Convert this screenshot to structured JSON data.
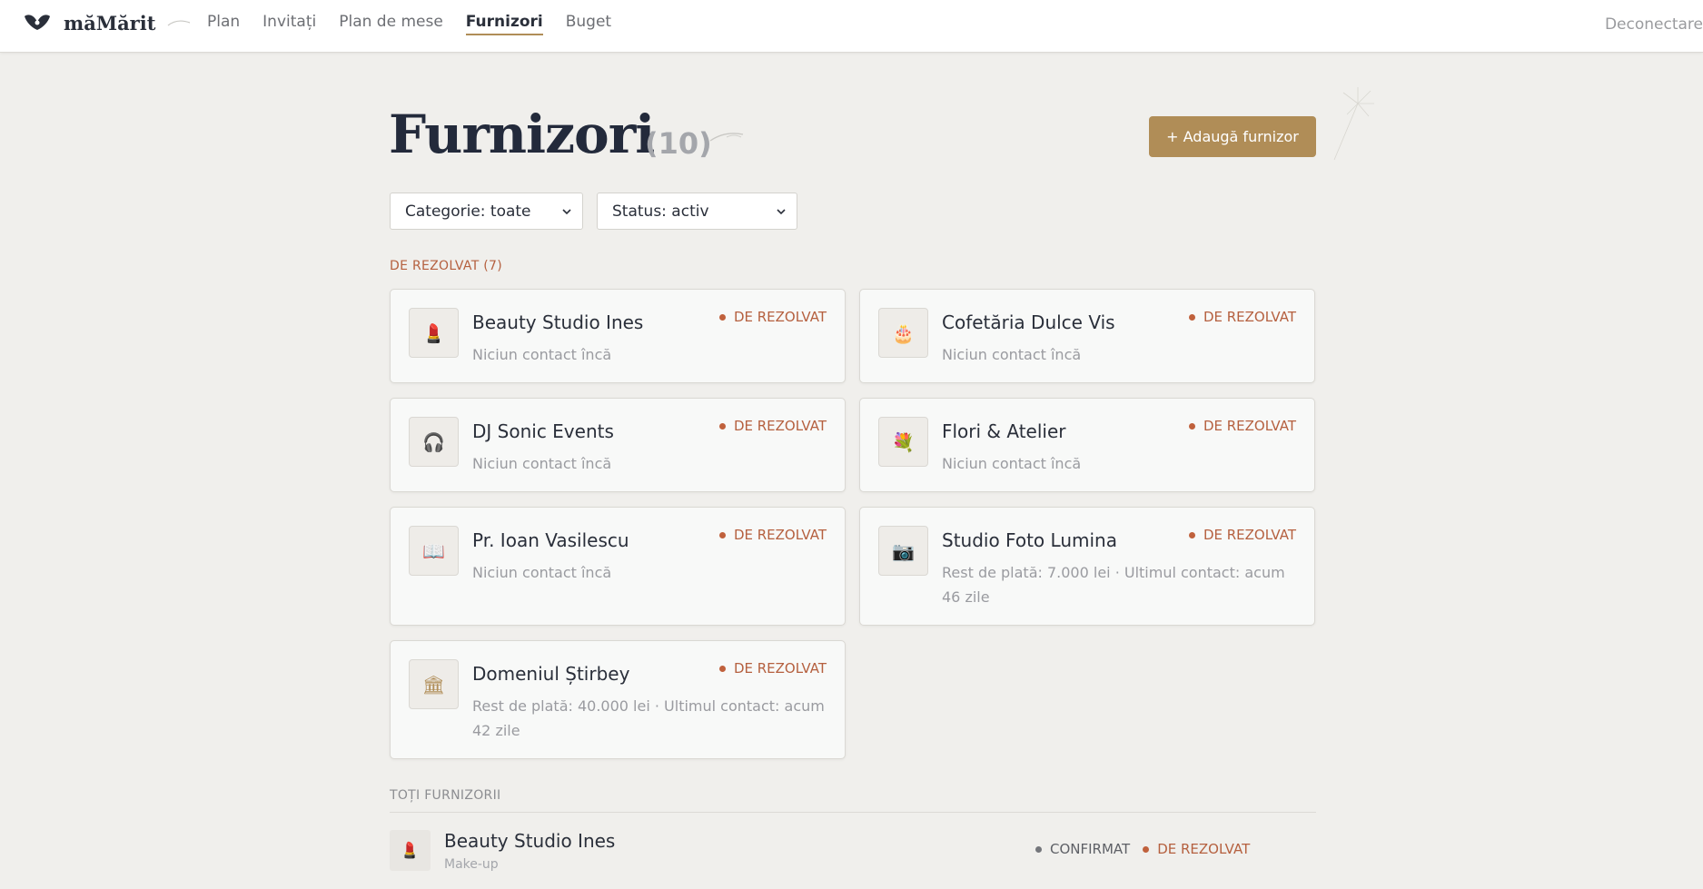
{
  "brand": {
    "name": "măMărit"
  },
  "nav": [
    {
      "label": "Plan"
    },
    {
      "label": "Invitați"
    },
    {
      "label": "Plan de mese"
    },
    {
      "label": "Furnizori"
    },
    {
      "label": "Buget"
    }
  ],
  "logout_label": "Deconectare",
  "header": {
    "title": "Furnizori",
    "count": "(10)",
    "add_button": "+ Adaugă furnizor"
  },
  "filters": {
    "category": "Categorie: toate",
    "status": "Status: activ"
  },
  "sections": {
    "pending": "DE REZOLVAT (7)",
    "all": "TOȚI FURNIZORII"
  },
  "cards": [
    {
      "name": "Beauty Studio Ines",
      "sub": "Niciun contact încă",
      "status": "DE REZOLVAT",
      "icon": "lipstick-icon"
    },
    {
      "name": "Cofetăria Dulce Vis",
      "sub": "Niciun contact încă",
      "status": "DE REZOLVAT",
      "icon": "cake-icon"
    },
    {
      "name": "DJ Sonic Events",
      "sub": "Niciun contact încă",
      "status": "DE REZOLVAT",
      "icon": "headphones-icon"
    },
    {
      "name": "Flori & Atelier",
      "sub": "Niciun contact încă",
      "status": "DE REZOLVAT",
      "icon": "bouquet-icon"
    },
    {
      "name": "Pr. Ioan Vasilescu",
      "sub": "Niciun contact încă",
      "status": "DE REZOLVAT",
      "icon": "open-book-icon"
    },
    {
      "name": "Studio Foto Lumina",
      "sub": "Rest de plată: 7.000 lei · Ultimul contact: acum 46 zile",
      "status": "DE REZOLVAT",
      "icon": "camera-icon"
    },
    {
      "name": "Domeniul Știrbey",
      "sub": "Rest de plată: 40.000 lei · Ultimul contact: acum 42 zile",
      "status": "DE REZOLVAT",
      "icon": "venue-icon"
    }
  ],
  "list": [
    {
      "name": "Beauty Studio Ines",
      "category": "Make-up",
      "badge1": "CONFIRMAT",
      "badge2": "DE REZOLVAT",
      "icon": "lipstick-icon"
    }
  ],
  "colors": {
    "accent": "#b08d57",
    "pending": "#c0613c",
    "title": "#232a3b",
    "background": "#f0efec"
  }
}
